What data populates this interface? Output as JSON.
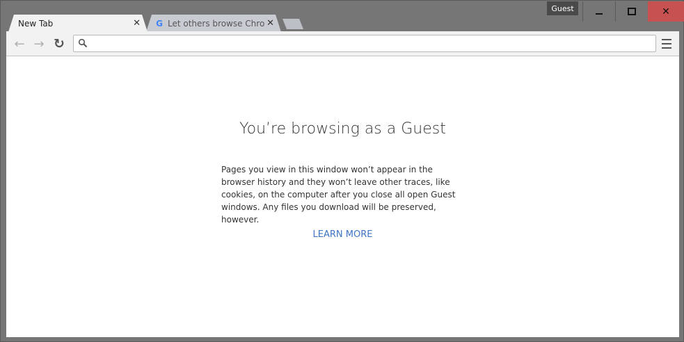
{
  "window": {
    "profile_badge": "Guest",
    "controls": {
      "minimize": "minimize",
      "maximize": "maximize",
      "close": "close"
    }
  },
  "tabs": [
    {
      "title": "New Tab",
      "active": true
    },
    {
      "title": "Let others browse Chrome",
      "active": false,
      "favicon": "G"
    }
  ],
  "toolbar": {
    "back_icon": "←",
    "forward_icon": "→",
    "reload_icon": "↻",
    "omnibox_value": "",
    "omnibox_placeholder": ""
  },
  "page": {
    "heading": "You’re browsing as a Guest",
    "body": "Pages you view in this window won’t appear in the browser history and they won’t leave other traces, like cookies, on the computer after you close all open Guest windows. Any files you download will be preserved, however.",
    "learn_more": "LEARN MORE",
    "link_color": "#3f74c4"
  }
}
